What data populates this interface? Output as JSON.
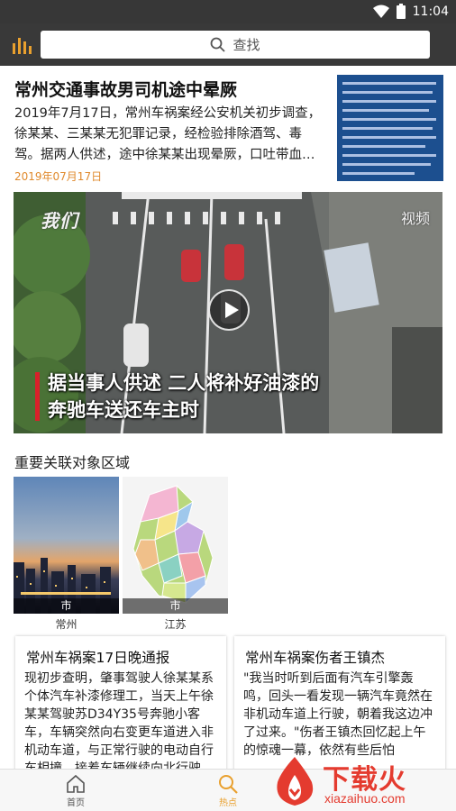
{
  "status_bar": {
    "time": "11:04"
  },
  "search": {
    "placeholder": "查找"
  },
  "news": {
    "title": "常州交通事故男司机途中晕厥",
    "body": "2019年7月17日，常州车祸案经公安机关初步调查，徐某某、三某某无犯罪记录，经检验排除酒驾、毒驾。据两人供述，途中徐某某出现晕厥，口吐带血…",
    "date": "2019年07月17日"
  },
  "video": {
    "logo": "我们",
    "brand": "视频",
    "caption_line1": "据当事人供述 二人将补好油漆的",
    "caption_line2": "奔驰车送还车主时"
  },
  "related": {
    "title": "重要关联对象区域",
    "regions": [
      {
        "tag": "市",
        "name": "常州"
      },
      {
        "tag": "市",
        "name": "江苏"
      }
    ]
  },
  "cards": [
    {
      "title": "常州车祸案17日晚通报",
      "text": "现初步查明，肇事驾驶人徐某某系个体汽车补漆修理工，当天上午徐某某驾驶苏D34Y35号奔驰小客车，车辆突然向右变更车道进入非机动车道，与正常行驶的电动自行车相撞，接着车辆继续向北行驶，与正"
    },
    {
      "title": "常州车祸案伤者王镇杰",
      "text": "\"我当时听到后面有汽车引擎轰鸣，回头一看发现一辆汽车竟然在非机动车道上行驶，朝着我这边冲了过来。\"伤者王镇杰回忆起上午的惊魂一幕，依然有些后怕"
    }
  ],
  "tabbar": {
    "items": [
      {
        "label": "首页",
        "icon": "home-icon"
      },
      {
        "label": "热点",
        "icon": "search-icon"
      }
    ]
  },
  "watermark": {
    "text": "下载火",
    "url": "xiazaihuo.com"
  },
  "colors": {
    "accent": "#e9a02e",
    "date": "#e08a2d",
    "watermark": "#e43b2f",
    "topbar": "#393939"
  }
}
